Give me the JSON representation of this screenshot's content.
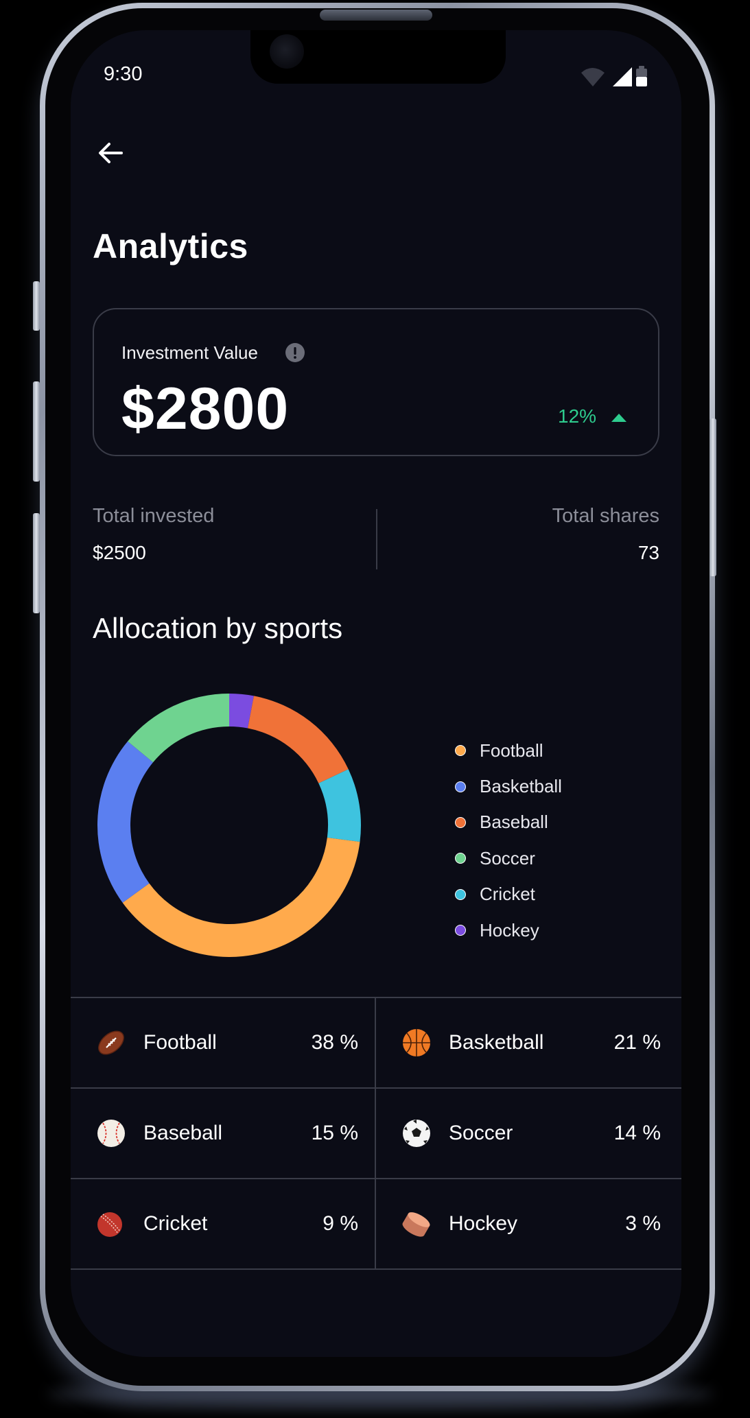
{
  "status_bar": {
    "time": "9:30"
  },
  "header": {
    "title": "Analytics"
  },
  "investment": {
    "label": "Investment Value",
    "value": "$2800",
    "change": "12%",
    "change_color": "#2ecc8e"
  },
  "stats": {
    "total_invested_label": "Total invested",
    "total_invested_value": "$2500",
    "total_shares_label": "Total shares",
    "total_shares_value": "73"
  },
  "allocation": {
    "title": "Allocation by sports",
    "legend": [
      {
        "label": "Football",
        "color": "#ffaa4c"
      },
      {
        "label": "Basketball",
        "color": "#5b7ff0"
      },
      {
        "label": "Baseball",
        "color": "#f07238"
      },
      {
        "label": "Soccer",
        "color": "#6fd390"
      },
      {
        "label": "Cricket",
        "color": "#3ec3df"
      },
      {
        "label": "Hockey",
        "color": "#7b4ce0"
      }
    ],
    "items": [
      {
        "name": "Football",
        "percent": "38 %",
        "icon": "football-icon"
      },
      {
        "name": "Basketball",
        "percent": "21 %",
        "icon": "basketball-icon"
      },
      {
        "name": "Baseball",
        "percent": "15 %",
        "icon": "baseball-icon"
      },
      {
        "name": "Soccer",
        "percent": "14 %",
        "icon": "soccer-ball-icon"
      },
      {
        "name": "Cricket",
        "percent": "9 %",
        "icon": "cricket-ball-icon"
      },
      {
        "name": "Hockey",
        "percent": "3 %",
        "icon": "hockey-puck-icon"
      }
    ]
  },
  "chart_data": {
    "type": "pie",
    "variant": "donut",
    "categories": [
      "Football",
      "Basketball",
      "Baseball",
      "Soccer",
      "Cricket",
      "Hockey"
    ],
    "values": [
      38,
      21,
      15,
      14,
      9,
      3
    ],
    "colors": [
      "#ffaa4c",
      "#5b7ff0",
      "#f07238",
      "#6fd390",
      "#3ec3df",
      "#7b4ce0"
    ],
    "title": "Allocation by sports",
    "legend": "right"
  }
}
